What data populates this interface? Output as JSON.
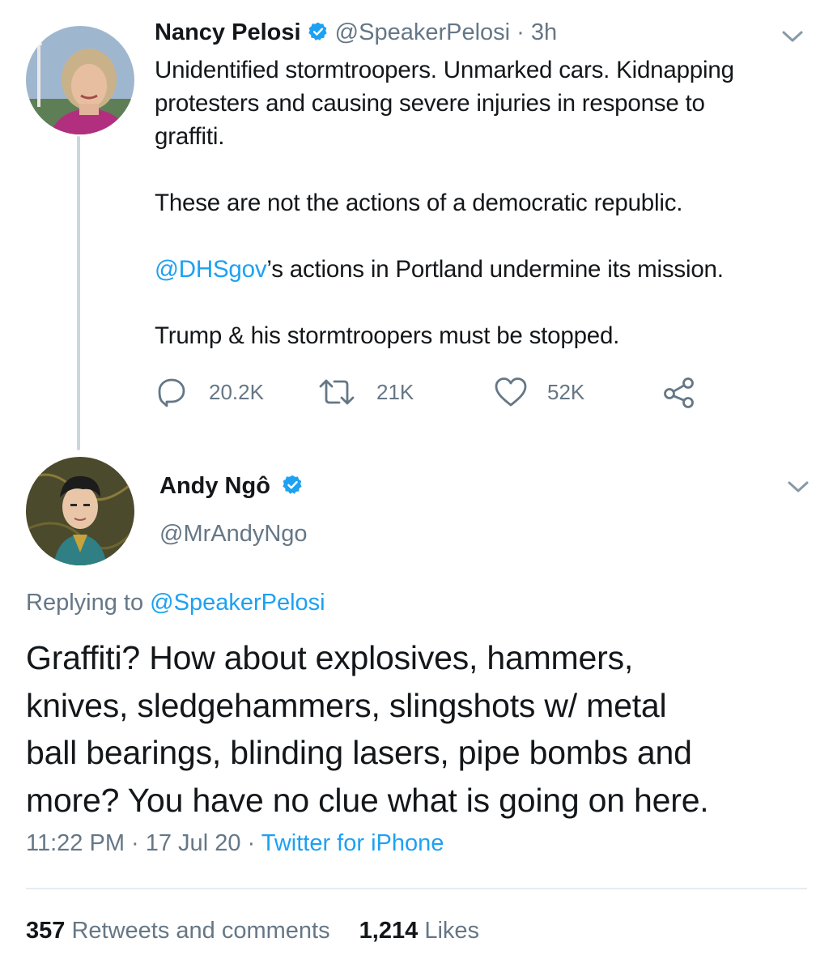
{
  "tweet1": {
    "name": "Nancy Pelosi",
    "handle": "@SpeakerPelosi",
    "time": "· 3h",
    "lines": [
      "Unidentified stormtroopers. Unmarked cars. Kidnapping",
      "protesters and causing severe injuries in response to",
      "graffiti."
    ],
    "line2": "These are not the actions of a democratic republic.",
    "mention": "@DHSgov",
    "line3_rest": "’s actions in Portland undermine its mission.",
    "line4": "Trump & his stormtroopers must be stopped.",
    "reply_count": "20.2K",
    "retweet_count": "21K",
    "like_count": "52K",
    "icons": [
      "reply-icon",
      "retweet-icon",
      "like-icon",
      "share-icon",
      "chevron-down-icon",
      "verified-icon"
    ]
  },
  "tweet2": {
    "name": "Andy Ngô",
    "handle": "@MrAndyNgo",
    "replying_prefix": "Replying to",
    "replying_handle": "@SpeakerPelosi",
    "text_lines": [
      "Graffiti? How about explosives, hammers,",
      "knives, sledgehammers, slingshots w/ metal",
      "ball bearings, blinding lasers, pipe bombs and",
      "more? You have no clue what is going on here."
    ],
    "time": "11:22 PM · 17 Jul 20 ·",
    "client": "Twitter for iPhone",
    "retweets_count": "357",
    "retweets_label": "Retweets and comments",
    "likes_count": "1,214",
    "likes_label": "Likes"
  },
  "colors": {
    "link": "#1da1f2",
    "muted": "#657786",
    "text": "#14171a",
    "divider": "#e6ecf0",
    "thread_line": "#ccd6dd"
  }
}
